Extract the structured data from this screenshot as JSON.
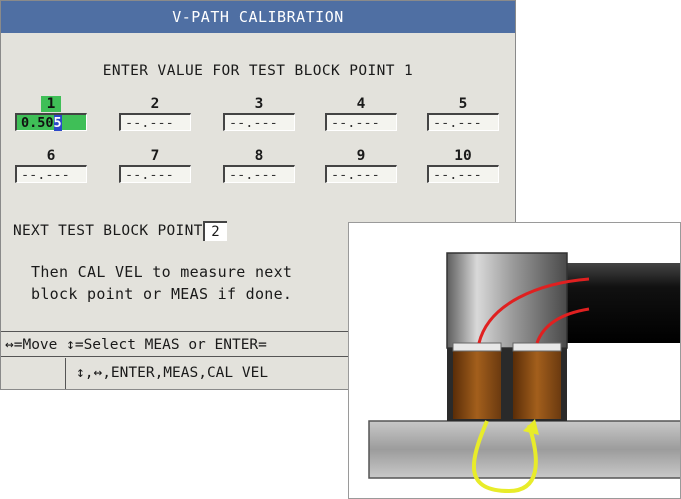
{
  "title": "V-PATH CALIBRATION",
  "prompt": "ENTER VALUE FOR TEST BLOCK POINT 1",
  "points": [
    {
      "label": "1",
      "value": "0.50",
      "cursor": "5",
      "active": true
    },
    {
      "label": "2",
      "value": "--.---"
    },
    {
      "label": "3",
      "value": "--.---"
    },
    {
      "label": "4",
      "value": "--.---"
    },
    {
      "label": "5",
      "value": "--.---"
    },
    {
      "label": "6",
      "value": "--.---"
    },
    {
      "label": "7",
      "value": "--.---"
    },
    {
      "label": "8",
      "value": "--.---"
    },
    {
      "label": "9",
      "value": "--.---"
    },
    {
      "label": "10",
      "value": "--.---"
    }
  ],
  "next_label": "NEXT TEST BLOCK POINT",
  "next_value": "2",
  "note_line1": "Then CAL VEL to measure next",
  "note_line2": "block point or MEAS if done.",
  "help_line1": "↔=Move ↕=Select MEAS or ENTER=",
  "help_line2": "↕,↔,ENTER,MEAS,CAL VEL",
  "colors": {
    "title_bar": "#4f6fa3",
    "active_field": "#3fbf57",
    "cursor": "#2b48c9",
    "screen_bg": "#e3e2dc",
    "transducer_crystal": "#8a4a14",
    "wire": "#e02020",
    "sound_path": "#e8ec2a"
  }
}
